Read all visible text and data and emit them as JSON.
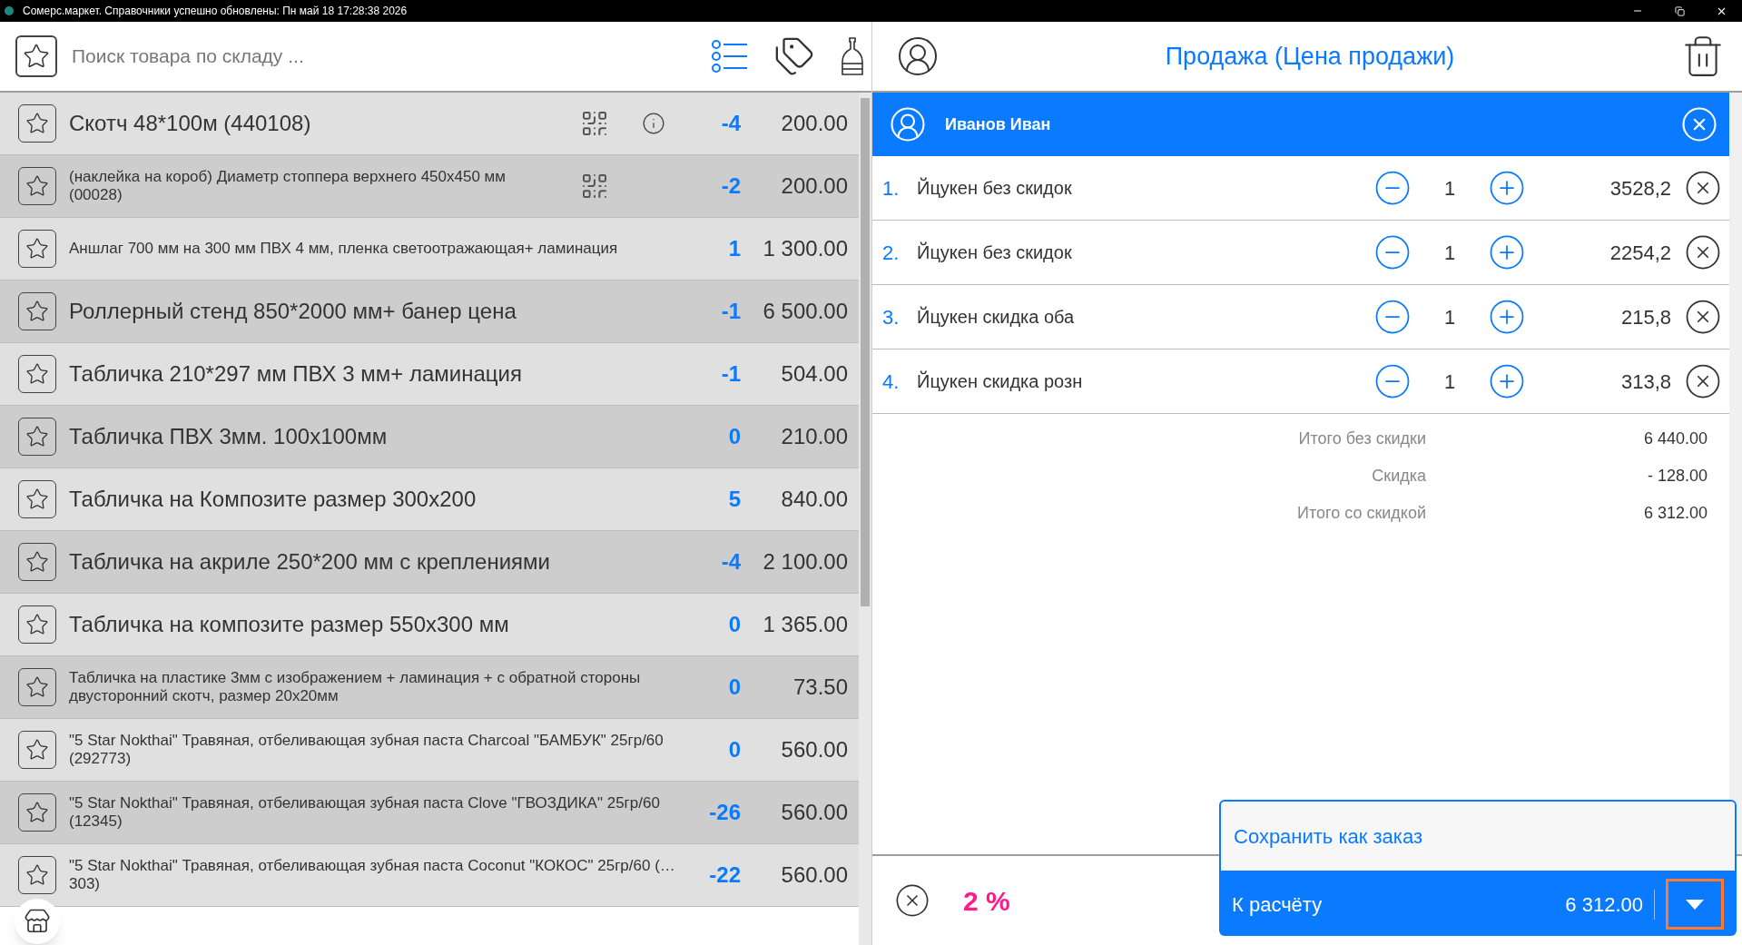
{
  "title_bar": {
    "text": "Сомерс.маркет. Справочники успешно обновлены: Пн май 18 17:28:38 2026"
  },
  "search": {
    "placeholder": "Поиск товара по складу ..."
  },
  "products": [
    {
      "name": "Скотч 48*100м (440108)",
      "quantity": "-4",
      "price": "200.00",
      "small_text": false,
      "qr": true,
      "info": true
    },
    {
      "name": "(наклейка на короб) Диаметр стоппера верхнего 450x450 мм (00028)",
      "quantity": "-2",
      "price": "200.00",
      "small_text": true,
      "qr": true,
      "info": false
    },
    {
      "name": "Аншлаг 700 мм на 300 мм ПВХ 4 мм, пленка светоотражающая+ ламинация",
      "quantity": "1",
      "price": "1 300.00",
      "small_text": true,
      "qr": false,
      "info": false
    },
    {
      "name": "Роллерный стенд 850*2000 мм+ банер цена",
      "quantity": "-1",
      "price": "6 500.00",
      "small_text": false,
      "qr": false,
      "info": false
    },
    {
      "name": "Табличка 210*297 мм ПВХ 3 мм+ ламинация",
      "quantity": "-1",
      "price": "504.00",
      "small_text": false,
      "qr": false,
      "info": false
    },
    {
      "name": "Табличка ПВХ 3мм. 100x100мм",
      "quantity": "0",
      "price": "210.00",
      "small_text": false,
      "qr": false,
      "info": false
    },
    {
      "name": "Табличка на Композите размер 300x200",
      "quantity": "5",
      "price": "840.00",
      "small_text": false,
      "qr": false,
      "info": false
    },
    {
      "name": "Табличка на акриле 250*200 мм с креплениями",
      "quantity": "-4",
      "price": "2 100.00",
      "small_text": false,
      "qr": false,
      "info": false
    },
    {
      "name": "Табличка на композите размер 550x300 мм",
      "quantity": "0",
      "price": "1 365.00",
      "small_text": false,
      "qr": false,
      "info": false
    },
    {
      "name": "Табличка на пластике 3мм с изображением + ламинация + с обратной стороны двусторонний скотч, размер 20x20мм",
      "quantity": "0",
      "price": "73.50",
      "small_text": true,
      "qr": false,
      "info": false
    },
    {
      "name": "\"5 Star Nokthai\" Травяная, отбеливающая зубная паста Charcoal \"БАМБУК\" 25гр/60 (292773)",
      "quantity": "0",
      "price": "560.00",
      "small_text": true,
      "qr": false,
      "info": false
    },
    {
      "name": "\"5 Star Nokthai\" Травяная, отбеливающая зубная паста Clove \"ГВОЗДИКА\" 25гр/60 (12345)",
      "quantity": "-26",
      "price": "560.00",
      "small_text": true,
      "qr": false,
      "info": false
    },
    {
      "name": "\"5 Star Nokthai\" Травяная, отбеливающая зубная паста Coconut \"КОКОС\" 25гр/60 (…303)",
      "quantity": "-22",
      "price": "560.00",
      "small_text": true,
      "qr": false,
      "info": false
    }
  ],
  "sale": {
    "title": "Продажа (Цена продажи)",
    "customer": "Иванов Иван",
    "items": [
      {
        "number": "1.",
        "name": "Йцукен без скидок",
        "quantity": "1",
        "price": "3528,2"
      },
      {
        "number": "2.",
        "name": "Йцукен без скидок",
        "quantity": "1",
        "price": "2254,2"
      },
      {
        "number": "3.",
        "name": "Йцукен скидка оба",
        "quantity": "1",
        "price": "215,8"
      },
      {
        "number": "4.",
        "name": "Йцукен скидка розн",
        "quantity": "1",
        "price": "313,8"
      }
    ],
    "totals": [
      {
        "label": "Итого без скидки",
        "value": "6 440.00"
      },
      {
        "label": "Скидка",
        "value": "- 128.00"
      },
      {
        "label": "Итого со скидкой",
        "value": "6 312.00"
      }
    ],
    "discount": "2 %",
    "save_order": "Сохранить как заказ",
    "checkout": {
      "label": "К расчёту",
      "amount": "6 312.00"
    }
  }
}
